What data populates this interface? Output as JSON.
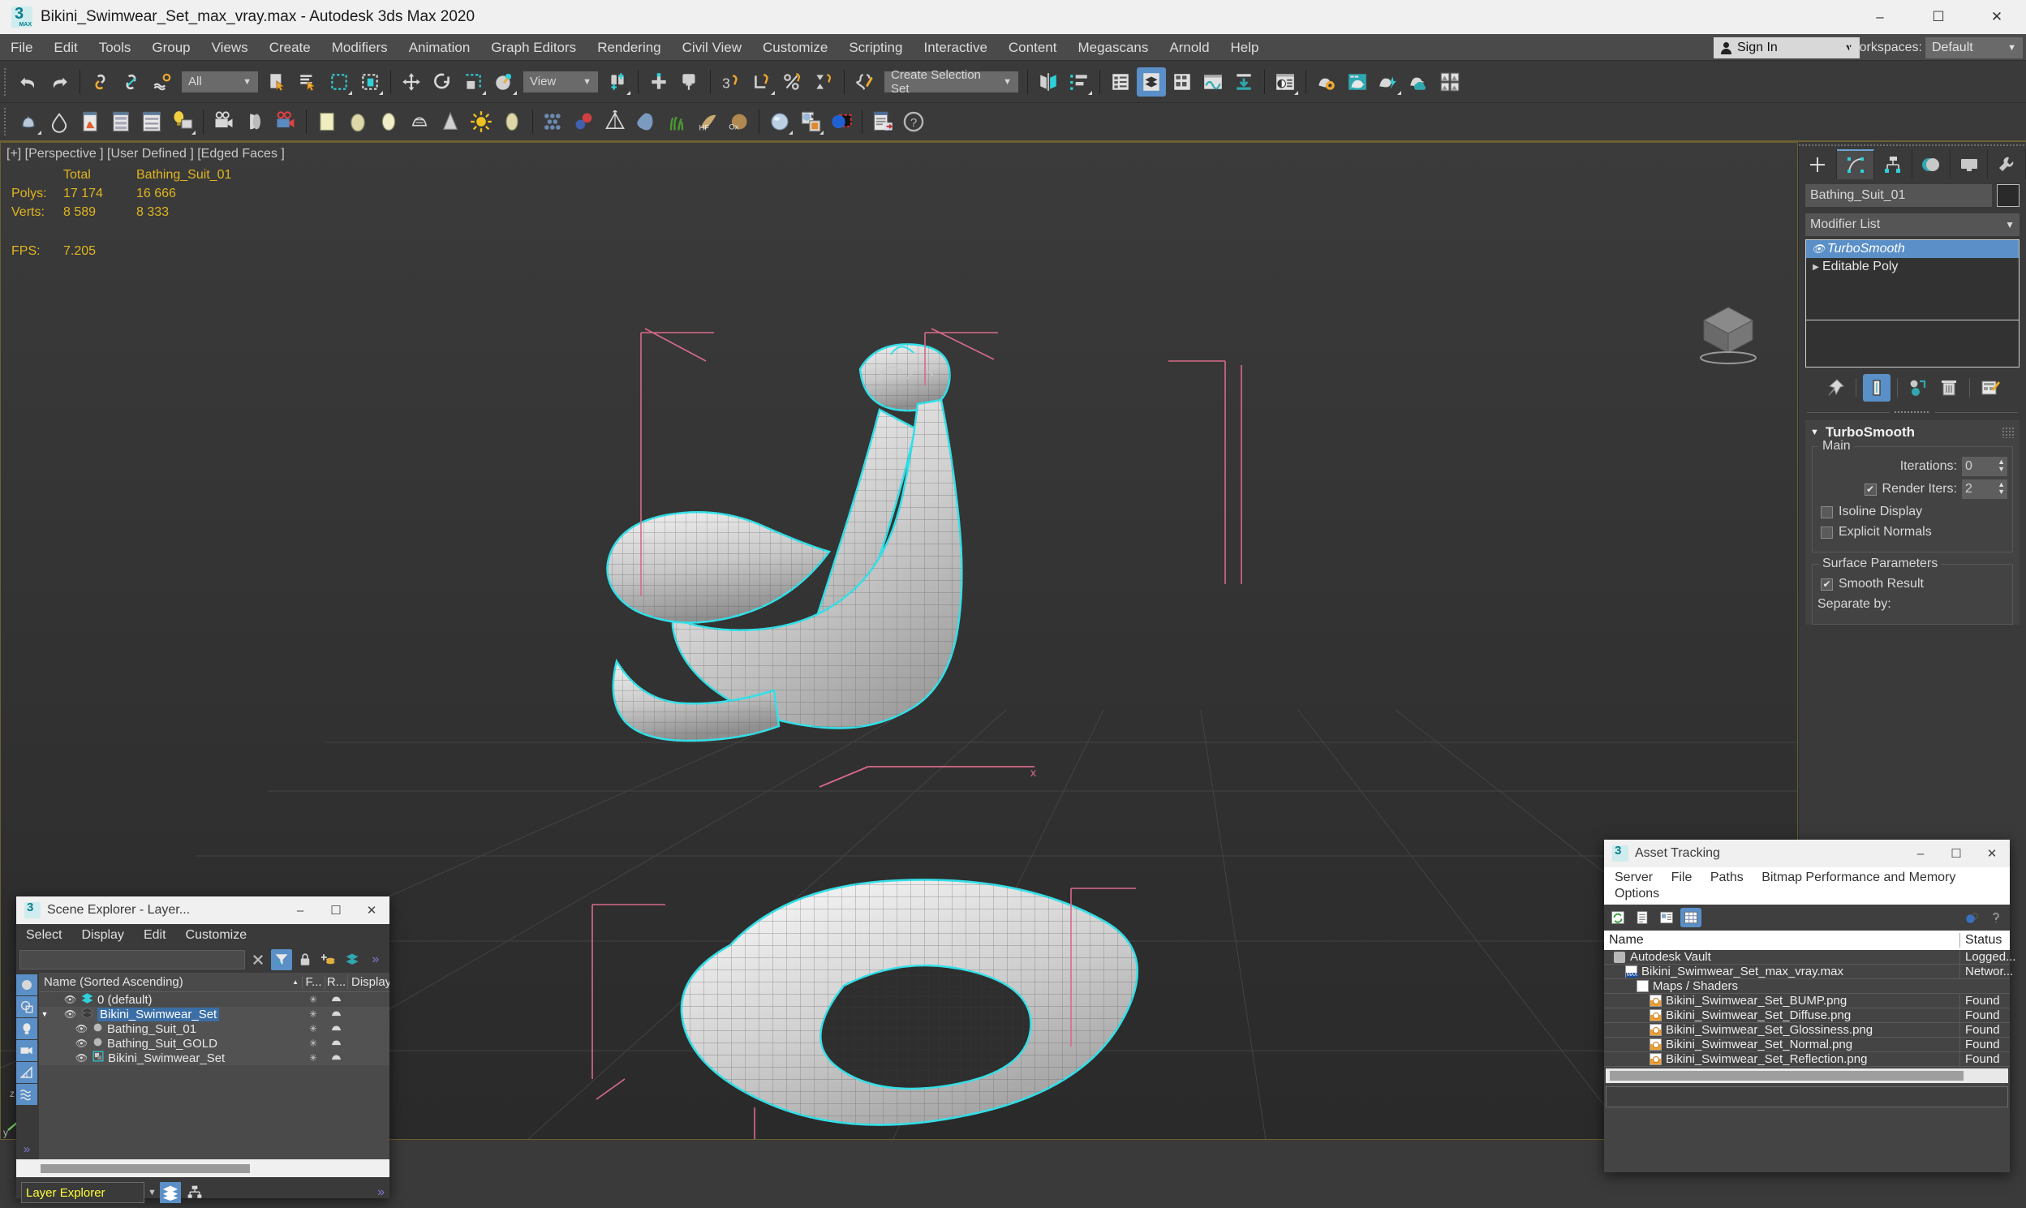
{
  "titlebar": {
    "title": "Bikini_Swimwear_Set_max_vray.max - Autodesk 3ds Max 2020",
    "app_icon": "3dsmax-icon",
    "minimize": "–",
    "maximize": "☐",
    "close": "✕"
  },
  "menubar": {
    "items": [
      "File",
      "Edit",
      "Tools",
      "Group",
      "Views",
      "Create",
      "Modifiers",
      "Animation",
      "Graph Editors",
      "Rendering",
      "Civil View",
      "Customize",
      "Scripting",
      "Interactive",
      "Content",
      "Megascans",
      "Arnold",
      "Help"
    ],
    "signin_label": "Sign In",
    "workspaces_label": "Workspaces:",
    "workspace_value": "Default"
  },
  "toolbar": {
    "selection_filter": "All",
    "reference_coord": "View",
    "selection_set": "Create Selection Set",
    "caret": "▼"
  },
  "viewport": {
    "label": "[+] [Perspective ] [User Defined ] [Edged Faces ]",
    "stats": {
      "col_total": "Total",
      "col_object": "Bathing_Suit_01",
      "polys_label": "Polys:",
      "polys_total": "17 174",
      "polys_object": "16 666",
      "verts_label": "Verts:",
      "verts_total": "8 589",
      "verts_object": "8 333",
      "fps_label": "FPS:",
      "fps_value": "7.205"
    },
    "axis_x": "x",
    "axis_y": "y",
    "axis_z": "z"
  },
  "command_panel": {
    "object_name": "Bathing_Suit_01",
    "modifier_list_label": "Modifier List",
    "stack": [
      {
        "label": "TurboSmooth",
        "selected": true,
        "eye": true
      },
      {
        "label": "Editable Poly",
        "selected": false,
        "eye": false
      }
    ],
    "rollout_title": "TurboSmooth",
    "main_group": "Main",
    "iterations_label": "Iterations:",
    "iterations_value": "0",
    "render_iters_label": "Render Iters:",
    "render_iters_value": "2",
    "isoline_label": "Isoline Display",
    "explicit_normals_label": "Explicit Normals",
    "surface_group": "Surface Parameters",
    "smooth_result_label": "Smooth Result",
    "separate_by_label": "Separate by:",
    "check_mark": "✔",
    "caret": "▼",
    "tri_down": "▼",
    "tri_right": "▶"
  },
  "scene_explorer": {
    "title": "Scene Explorer - Layer...",
    "minimize": "–",
    "maximize": "☐",
    "close": "✕",
    "menu": [
      "Select",
      "Display",
      "Edit",
      "Customize"
    ],
    "search_value": "",
    "overflow": "»",
    "columns": [
      "Name (Sorted Ascending)",
      "F...",
      "R...",
      "Display"
    ],
    "rows": [
      {
        "name": "0 (default)",
        "indent": 1,
        "icon": "layer-icon",
        "selected": false,
        "expander": "",
        "eye": "◉",
        "freeze": "✳",
        "render": "teapot"
      },
      {
        "name": "Bikini_Swimwear_Set",
        "indent": 1,
        "icon": "layer-icon",
        "selected": true,
        "expander": "▼",
        "eye": "◉",
        "freeze": "✳",
        "render": "teapot"
      },
      {
        "name": "Bathing_Suit_01",
        "indent": 2,
        "icon": "object-icon",
        "selected": false,
        "expander": "",
        "eye": "◉",
        "freeze": "✳",
        "render": "teapot"
      },
      {
        "name": "Bathing_Suit_GOLD",
        "indent": 2,
        "icon": "object-icon",
        "selected": false,
        "expander": "",
        "eye": "◉",
        "freeze": "✳",
        "render": "teapot"
      },
      {
        "name": "Bikini_Swimwear_Set",
        "indent": 2,
        "icon": "group-icon",
        "selected": false,
        "expander": "",
        "eye": "◉",
        "freeze": "✳",
        "render": "teapot"
      }
    ],
    "footer_combo": "Layer Explorer"
  },
  "asset_tracking": {
    "title": "Asset Tracking",
    "minimize": "–",
    "maximize": "☐",
    "close": "✕",
    "menu": [
      "Server",
      "File",
      "Paths",
      "Bitmap Performance and Memory",
      "Options"
    ],
    "columns": {
      "name": "Name",
      "status": "Status"
    },
    "rows": [
      {
        "name": "Autodesk Vault",
        "status": "Logged...",
        "indent": 1,
        "icon": "vault-icon"
      },
      {
        "name": "Bikini_Swimwear_Set_max_vray.max",
        "status": "Networ...",
        "indent": 2,
        "icon": "max-file-icon"
      },
      {
        "name": "Maps / Shaders",
        "status": "",
        "indent": 3,
        "icon": "maps-icon"
      },
      {
        "name": "Bikini_Swimwear_Set_BUMP.png",
        "status": "Found",
        "indent": 4,
        "icon": "png-file-icon"
      },
      {
        "name": "Bikini_Swimwear_Set_Diffuse.png",
        "status": "Found",
        "indent": 4,
        "icon": "png-file-icon"
      },
      {
        "name": "Bikini_Swimwear_Set_Glossiness.png",
        "status": "Found",
        "indent": 4,
        "icon": "png-file-icon"
      },
      {
        "name": "Bikini_Swimwear_Set_Normal.png",
        "status": "Found",
        "indent": 4,
        "icon": "png-file-icon"
      },
      {
        "name": "Bikini_Swimwear_Set_Reflection.png",
        "status": "Found",
        "indent": 4,
        "icon": "png-file-icon"
      }
    ]
  },
  "colors": {
    "accent_blue": "#5a8fc7",
    "selection_cyan": "#33e0e8",
    "stat_yellow": "#e0b51f",
    "gizmo_pink": "#d86a8a",
    "panel_bg": "#3a3a3a",
    "viewport_bg": "#383838"
  }
}
